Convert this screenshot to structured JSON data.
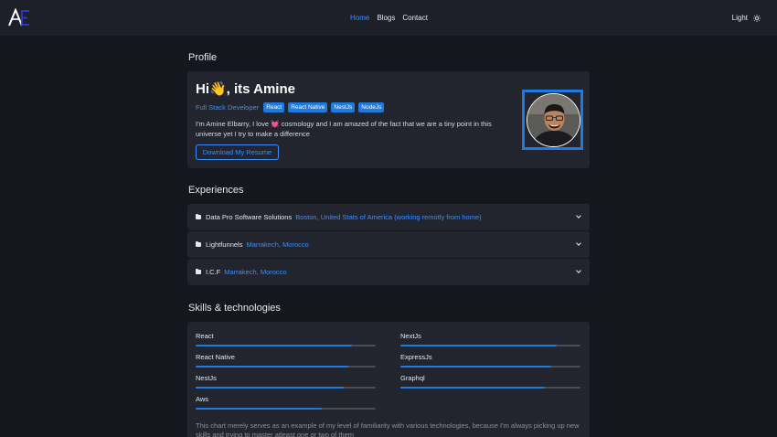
{
  "nav": {
    "logo_text": "AE",
    "links": [
      {
        "label": "Home",
        "active": true
      },
      {
        "label": "Blogs",
        "active": false
      },
      {
        "label": "Contact",
        "active": false
      }
    ],
    "theme_label": "Light",
    "theme_icon": "sun-icon"
  },
  "profile": {
    "section_title": "Profile",
    "greeting": "Hi👋, its Amine",
    "role": "Full Stack Developer",
    "tags": [
      "React",
      "React Native",
      "NestJs",
      "NodeJs"
    ],
    "bio": "I'm Amine Elbarry, I love 💓 cosmology and I am amazed of the fact that we are a tiny point in this universe yet I try to make a difference",
    "resume_button": "Download My Resume"
  },
  "experiences": {
    "section_title": "Experiences",
    "items": [
      {
        "company": "Data Pro Software Solutions",
        "location": "Boston, United Stats of America (working remotly from home)"
      },
      {
        "company": "Lightfunnels",
        "location": "Marrakech, Morocco"
      },
      {
        "company": "I.C.F",
        "location": "Marrakech, Morocco"
      }
    ]
  },
  "skills": {
    "section_title": "Skills & technologies",
    "items": [
      {
        "name": "React",
        "level": 0.87
      },
      {
        "name": "NextJs",
        "level": 0.87
      },
      {
        "name": "React Native",
        "level": 0.85
      },
      {
        "name": "ExpressJs",
        "level": 0.84
      },
      {
        "name": "NestJs",
        "level": 0.82
      },
      {
        "name": "Graphql",
        "level": 0.8
      },
      {
        "name": "Aws",
        "level": 0.7
      }
    ],
    "note": "This chart merely serves as an example of my level of familiarity with various technologies, because I'm always picking up new skills and trying to master atleast one or two of them"
  },
  "colors": {
    "accent": "#3b8cff",
    "background": "#15171e",
    "card": "#22252e"
  }
}
